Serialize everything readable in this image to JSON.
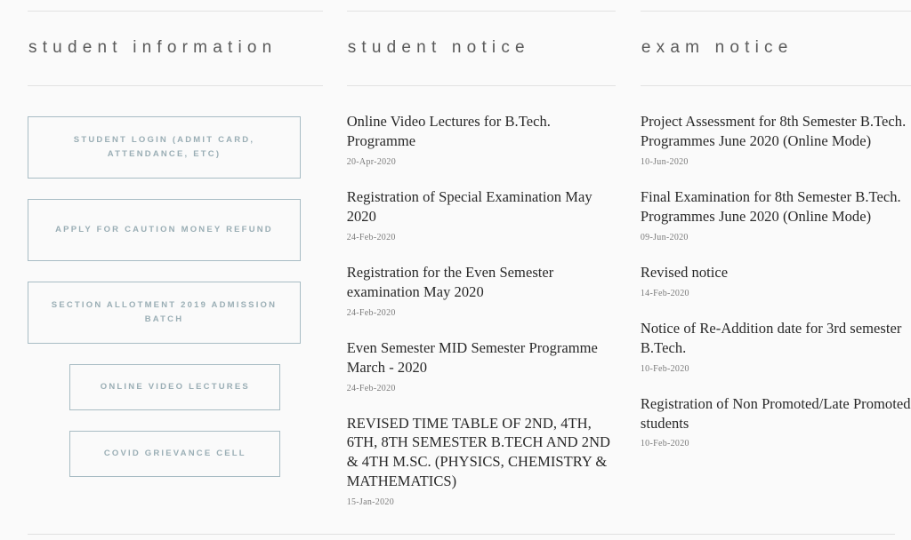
{
  "columns": {
    "student_information": {
      "heading": "student information",
      "buttons": [
        {
          "label": "STUDENT LOGIN (ADMIT CARD, ATTENDANCE, ETC)",
          "width": "wide"
        },
        {
          "label": "APPLY FOR CAUTION MONEY REFUND",
          "width": "wide"
        },
        {
          "label": "SECTION ALLOTMENT 2019 ADMISSION BATCH",
          "width": "wide"
        },
        {
          "label": "ONLINE VIDEO LECTURES",
          "width": "narrow"
        },
        {
          "label": "COVID GRIEVANCE CELL",
          "width": "narrow"
        }
      ]
    },
    "student_notice": {
      "heading": "student notice",
      "notices": [
        {
          "title": "Online Video Lectures for B.Tech. Programme",
          "date": "20-Apr-2020"
        },
        {
          "title": "Registration of Special Examination May 2020",
          "date": "24-Feb-2020"
        },
        {
          "title": "Registration for the Even Semester examination May 2020",
          "date": "24-Feb-2020"
        },
        {
          "title": "Even Semester MID Semester Programme March - 2020",
          "date": "24-Feb-2020"
        },
        {
          "title": "REVISED TIME TABLE OF 2ND, 4TH, 6TH, 8TH SEMESTER B.TECH AND 2ND & 4TH M.SC. (PHYSICS, CHEMISTRY & MATHEMATICS)",
          "date": "15-Jan-2020"
        }
      ]
    },
    "exam_notice": {
      "heading": "exam notice",
      "notices": [
        {
          "title": "Project Assessment for 8th Semester B.Tech. Programmes June 2020 (Online Mode)",
          "date": "10-Jun-2020"
        },
        {
          "title": "Final Examination for 8th Semester B.Tech. Programmes June 2020 (Online Mode)",
          "date": "09-Jun-2020"
        },
        {
          "title": "Revised notice",
          "date": "14-Feb-2020"
        },
        {
          "title": "Notice of Re-Addition date for 3rd semester B.Tech.",
          "date": "10-Feb-2020"
        },
        {
          "title": "Registration of Non Promoted/Late Promoted students",
          "date": "10-Feb-2020"
        }
      ]
    }
  },
  "theme": {
    "background": "#fafafa",
    "rule_color": "#e2e2e2",
    "heading_color": "#5a5a5a",
    "button_border": "#a8bcc4",
    "button_text": "#9aaeb5",
    "notice_title_color": "#282828",
    "notice_date_color": "#7b7b7b"
  }
}
